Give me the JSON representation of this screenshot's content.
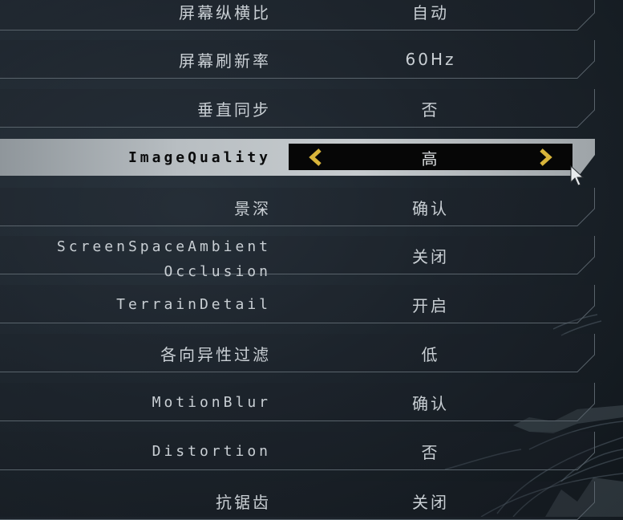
{
  "menu": {
    "rows": [
      {
        "label": "屏幕纵横比",
        "value": "自动"
      },
      {
        "label": "屏幕刷新率",
        "value": "60Hz"
      },
      {
        "label": "垂直同步",
        "value": "否"
      },
      {
        "label": "ImageQuality",
        "value": "高",
        "selected": true
      },
      {
        "label": "景深",
        "value": "确认"
      },
      {
        "label_line1": "ScreenSpaceAmbient",
        "label_line2": "Occlusion",
        "value": "关闭"
      },
      {
        "label": "TerrainDetail",
        "value": "开启"
      },
      {
        "label": "各向异性过滤",
        "value": "低"
      },
      {
        "label": "MotionBlur",
        "value": "确认"
      },
      {
        "label": "Distortion",
        "value": "否"
      },
      {
        "label": "抗锯齿",
        "value": "关闭"
      }
    ]
  },
  "icons": {
    "prev": "chevron-left-icon",
    "next": "chevron-right-icon",
    "cursor": "mouse-pointer-icon"
  },
  "colors": {
    "arrow_accent": "#d8b43a",
    "text": "#c9cfd4",
    "selected_text": "#0a0b0c"
  }
}
